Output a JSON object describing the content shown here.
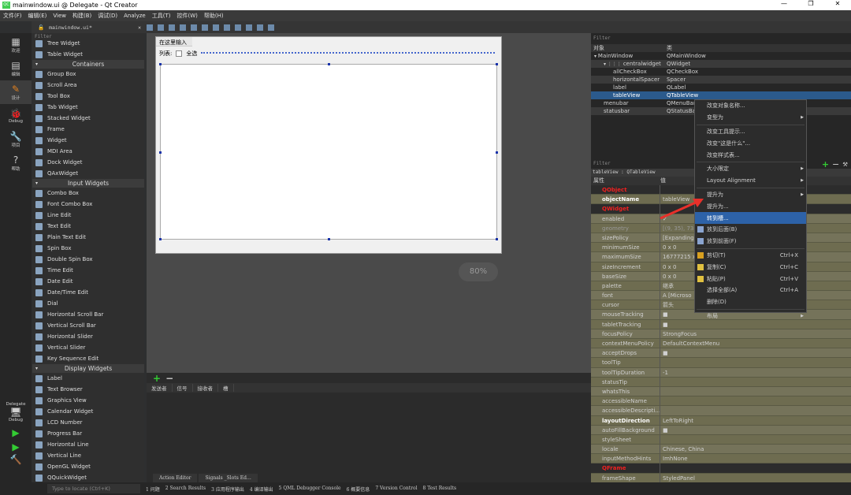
{
  "window": {
    "title": "mainwindow.ui @ Delegate - Qt Creator",
    "logo": "QC",
    "controls": [
      "—",
      "❐",
      "✕"
    ]
  },
  "menu": [
    "文件(F)",
    "编辑(E)",
    "View",
    "构建(B)",
    "调试(D)",
    "Analyze",
    "工具(T)",
    "控件(W)",
    "帮助(H)"
  ],
  "editor": {
    "file": "mainwindow.ui*"
  },
  "modes": [
    {
      "label": "欢迎",
      "icon": "grid-icon"
    },
    {
      "label": "编辑",
      "icon": "document-icon"
    },
    {
      "label": "设计",
      "icon": "pencil-icon"
    },
    {
      "label": "Debug",
      "icon": "bug-icon"
    },
    {
      "label": "项目",
      "icon": "wrench-icon"
    },
    {
      "label": "帮助",
      "icon": "help-icon"
    }
  ],
  "kit": {
    "project": "Delegate",
    "config": "Debug"
  },
  "widgetbox": {
    "filter": "Filter",
    "groups": [
      {
        "title": "",
        "items": [
          "Tree Widget",
          "Table Widget"
        ]
      },
      {
        "title": "Containers",
        "items": [
          "Group Box",
          "Scroll Area",
          "Tool Box",
          "Tab Widget",
          "Stacked Widget",
          "Frame",
          "Widget",
          "MDI Area",
          "Dock Widget",
          "QAxWidget"
        ]
      },
      {
        "title": "Input Widgets",
        "items": [
          "Combo Box",
          "Font Combo Box",
          "Line Edit",
          "Text Edit",
          "Plain Text Edit",
          "Spin Box",
          "Double Spin Box",
          "Time Edit",
          "Date Edit",
          "Date/Time Edit",
          "Dial",
          "Horizontal Scroll Bar",
          "Vertical Scroll Bar",
          "Horizontal Slider",
          "Vertical Slider",
          "Key Sequence Edit"
        ]
      },
      {
        "title": "Display Widgets",
        "items": [
          "Label",
          "Text Browser",
          "Graphics View",
          "Calendar Widget",
          "LCD Number",
          "Progress Bar",
          "Horizontal Line",
          "Vertical Line",
          "OpenGL Widget",
          "QQuickWidget"
        ]
      }
    ]
  },
  "form": {
    "menu_placeholder": "在这里输入",
    "label": "列表:",
    "checkbox": "全选"
  },
  "zoom": "80%",
  "signals": {
    "add": "+",
    "remove": "−",
    "columns": [
      "发送者",
      "信号",
      "接收者",
      "槽"
    ],
    "tabs": [
      "Action Editor",
      "Signals _Slots Ed…"
    ]
  },
  "object_inspector": {
    "filter": "Filter",
    "columns": [
      "对象",
      "类"
    ],
    "rows": [
      {
        "name": "MainWindow",
        "class": "QMainWindow",
        "indent": 0,
        "arrow": "▾"
      },
      {
        "name": "centralwidget",
        "class": "QWidget",
        "indent": 1,
        "arrow": "▾ ⋮⋮⋮"
      },
      {
        "name": "allCheckBox",
        "class": "QCheckBox",
        "indent": 2,
        "arrow": ""
      },
      {
        "name": "horizontalSpacer",
        "class": "Spacer",
        "indent": 2,
        "arrow": ""
      },
      {
        "name": "label",
        "class": "QLabel",
        "indent": 2,
        "arrow": ""
      },
      {
        "name": "tableView",
        "class": "QTableView",
        "indent": 2,
        "arrow": "",
        "selected": true
      },
      {
        "name": "menubar",
        "class": "QMenuBar",
        "indent": 1,
        "arrow": ""
      },
      {
        "name": "statusbar",
        "class": "QStatusBar",
        "indent": 1,
        "arrow": ""
      }
    ]
  },
  "property_editor": {
    "filter": "Filter",
    "object": "tableView : QTableView",
    "columns": [
      "属性",
      "值"
    ],
    "rows": [
      {
        "n": "QObject",
        "v": "",
        "t": "grp"
      },
      {
        "n": "objectName",
        "v": "tableView",
        "t": "b"
      },
      {
        "n": "QWidget",
        "v": "",
        "t": "grp"
      },
      {
        "n": "enabled",
        "v": "✓"
      },
      {
        "n": "geometry",
        "v": "[(9, 35), 738",
        "t": "dis"
      },
      {
        "n": "sizePolicy",
        "v": "[Expanding,"
      },
      {
        "n": "minimumSize",
        "v": "0 x 0"
      },
      {
        "n": "maximumSize",
        "v": "16777215 x"
      },
      {
        "n": "sizeIncrement",
        "v": "0 x 0"
      },
      {
        "n": "baseSize",
        "v": "0 x 0"
      },
      {
        "n": "palette",
        "v": "继承"
      },
      {
        "n": "font",
        "v": "A [Microso"
      },
      {
        "n": "cursor",
        "v": "箭头"
      },
      {
        "n": "mouseTracking",
        "v": "■"
      },
      {
        "n": "tabletTracking",
        "v": "■"
      },
      {
        "n": "focusPolicy",
        "v": "StrongFocus"
      },
      {
        "n": "contextMenuPolicy",
        "v": "DefaultContextMenu"
      },
      {
        "n": "acceptDrops",
        "v": "■"
      },
      {
        "n": "toolTip",
        "v": ""
      },
      {
        "n": "toolTipDuration",
        "v": "-1"
      },
      {
        "n": "statusTip",
        "v": ""
      },
      {
        "n": "whatsThis",
        "v": ""
      },
      {
        "n": "accessibleName",
        "v": ""
      },
      {
        "n": "accessibleDescripti...",
        "v": ""
      },
      {
        "n": "layoutDirection",
        "v": "LeftToRight",
        "t": "b"
      },
      {
        "n": "autoFillBackground",
        "v": "■"
      },
      {
        "n": "styleSheet",
        "v": ""
      },
      {
        "n": "locale",
        "v": "Chinese, China"
      },
      {
        "n": "inputMethodHints",
        "v": "ImhNone"
      },
      {
        "n": "QFrame",
        "v": "",
        "t": "grp"
      },
      {
        "n": "frameShape",
        "v": "StyledPanel"
      }
    ]
  },
  "context_menu": [
    {
      "label": "改变对象名称..."
    },
    {
      "label": "变型为",
      "sub": true
    },
    {
      "sep": true
    },
    {
      "label": "改变工具提示..."
    },
    {
      "label": "改变\"这是什么\"..."
    },
    {
      "label": "改变样式表..."
    },
    {
      "sep": true
    },
    {
      "label": "大小限定",
      "sub": true
    },
    {
      "label": "Layout Alignment",
      "sub": true
    },
    {
      "sep": true
    },
    {
      "label": "提升为",
      "sub": true
    },
    {
      "label": "提升为..."
    },
    {
      "label": "转到槽...",
      "selected": true
    },
    {
      "label": "放到后面(B)",
      "icon": "send-back-icon"
    },
    {
      "label": "放到前面(F)",
      "icon": "bring-front-icon"
    },
    {
      "sep": true
    },
    {
      "label": "剪切(T)",
      "sc": "Ctrl+X",
      "icon": "cut-icon"
    },
    {
      "label": "复制(C)",
      "sc": "Ctrl+C",
      "icon": "copy-icon"
    },
    {
      "label": "粘贴(P)",
      "sc": "Ctrl+V",
      "icon": "paste-icon"
    },
    {
      "label": "选择全部(A)",
      "sc": "Ctrl+A"
    },
    {
      "label": "删除(D)"
    },
    {
      "sep": true
    },
    {
      "label": "布局",
      "sub": true
    }
  ],
  "statusbar": {
    "locate_placeholder": "Type to locate (Ctrl+K)",
    "panes": [
      "1 问题",
      "2 Search Results",
      "3 应用程序输出",
      "4 编译输出",
      "5 QML Debugger Console",
      "6 概要信息",
      "7 Version Control",
      "8 Test Results"
    ]
  },
  "colors": {
    "accent": "#2b5a8c",
    "property_bg": "#6e6c50",
    "group_red": "#f02020",
    "arrow": "#e8302a"
  }
}
